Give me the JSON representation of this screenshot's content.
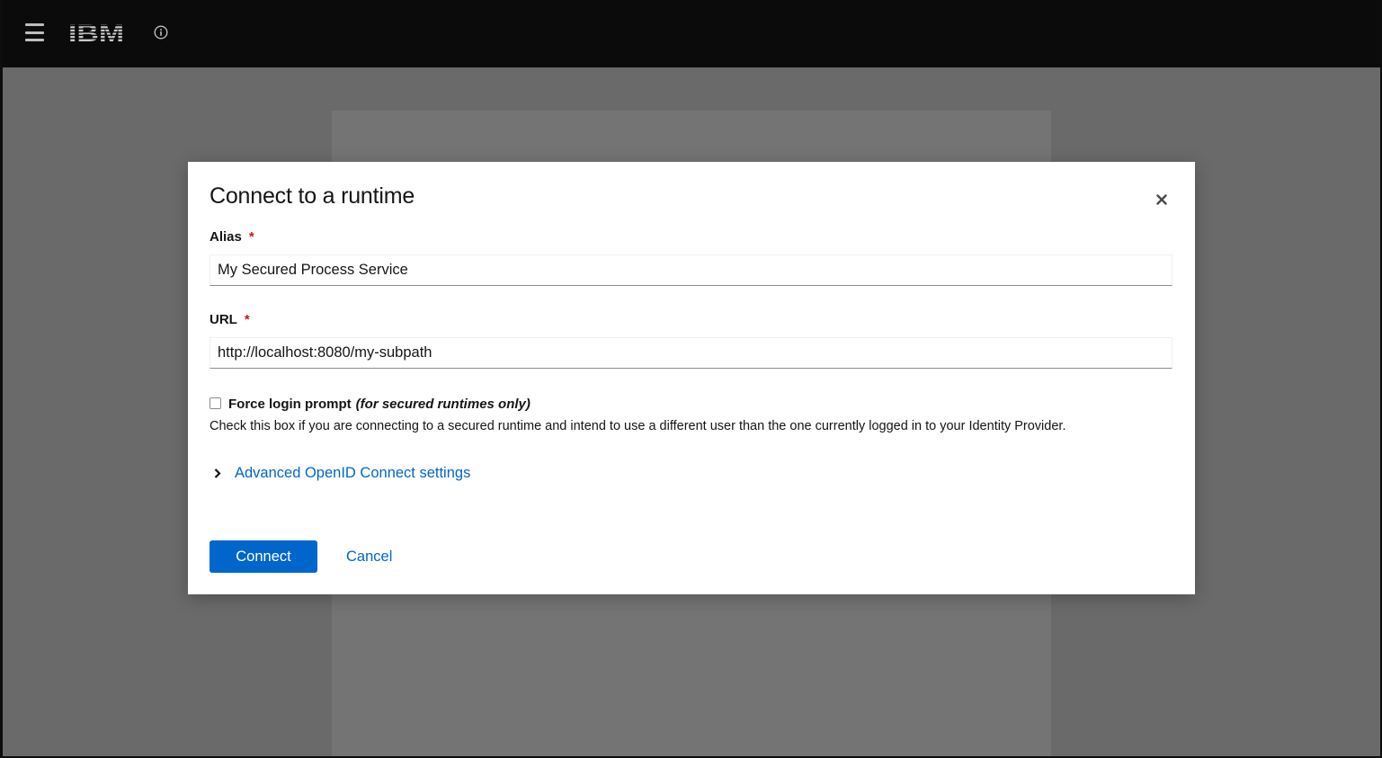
{
  "topbar": {
    "menu_icon": "hamburger-menu-icon",
    "logo_text": "IBM",
    "info_icon": "info-circle-icon"
  },
  "modal": {
    "title": "Connect to a runtime",
    "close_icon": "close-icon",
    "alias": {
      "label": "Alias",
      "required_mark": "*",
      "value": "My Secured Process Service"
    },
    "url": {
      "label": "URL",
      "required_mark": "*",
      "value": "http://localhost:8080/my-subpath"
    },
    "force_login": {
      "label": "Force login prompt",
      "label_note": "(for secured runtimes only)",
      "checked": false,
      "help": "Check this box if you are connecting to a secured runtime and intend to use a different user than the one currently logged in to your Identity Provider."
    },
    "advanced": {
      "icon": "chevron-right-icon",
      "label": "Advanced OpenID Connect settings"
    },
    "actions": {
      "connect_label": "Connect",
      "cancel_label": "Cancel"
    }
  },
  "colors": {
    "primary": "#0066cc",
    "required": "#c9190b",
    "topbar": "#0b0b0b",
    "backdrop": "#6a6a6a"
  }
}
